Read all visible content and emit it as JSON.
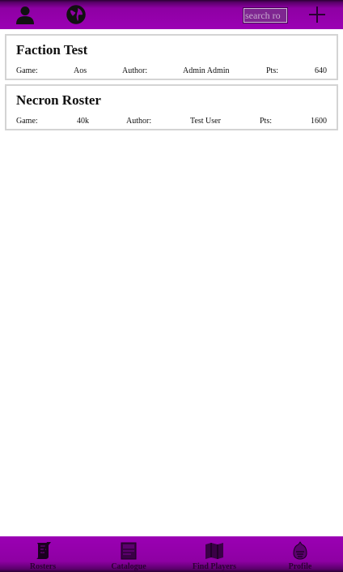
{
  "header": {
    "search": {
      "value": "search ro",
      "placeholder": "search rosters"
    },
    "icons": [
      "user-icon",
      "globe-icon",
      "plus-icon"
    ]
  },
  "rosters": [
    {
      "name": "Faction Test",
      "game_label": "Game:",
      "game": "Aos",
      "author_label": "Author:",
      "author": "Admin Admin",
      "points_label": "Pts:",
      "points": "640"
    },
    {
      "name": "Necron Roster",
      "game_label": "Game:",
      "game": "40k",
      "author_label": "Author:",
      "author": "Test User",
      "points_label": "Pts:",
      "points": "1600"
    }
  ],
  "bottom_nav": [
    {
      "label": "Rosters",
      "icon": "scroll-icon"
    },
    {
      "label": "Catalogue",
      "icon": "book-icon"
    },
    {
      "label": "Find Players",
      "icon": "map-icon"
    },
    {
      "label": "Profile",
      "icon": "helmet-icon"
    }
  ],
  "colors": {
    "bar": "#9b00b4",
    "bar_dark": "#2a0033",
    "card_border": "#d4d4d4",
    "nav_text": "#2b0033"
  }
}
